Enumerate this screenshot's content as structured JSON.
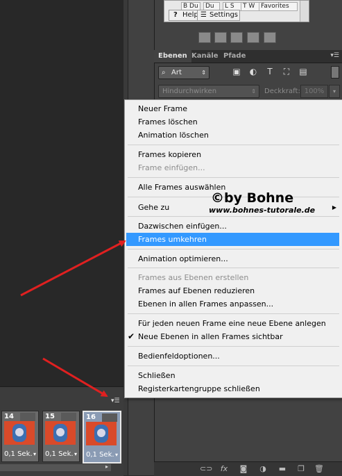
{
  "colors": {
    "menu_highlight": "#3399ff",
    "arrow": "#e02020",
    "panel_bg": "#424242"
  },
  "top_widget": {
    "cells": [
      "B Du",
      "Du",
      "L S",
      "T W",
      "Favorites"
    ],
    "help_tab": "Help",
    "settings_tab": "Settings",
    "help_icon": "question-icon",
    "settings_icon": "list-icon"
  },
  "layers_panel": {
    "tabs": [
      "Ebenen",
      "Kanäle",
      "Pfade"
    ],
    "active_tab": "Ebenen",
    "kind_filter": "Art",
    "filter_icons": [
      "image-filter-icon",
      "adjustment-filter-icon",
      "type-filter-icon",
      "shape-filter-icon",
      "smart-object-filter-icon"
    ],
    "blend_mode": "Hindurchwirken",
    "opacity_label": "Deckkraft:",
    "opacity_value": "100%",
    "bottom_icons": [
      "link-icon",
      "fx-icon",
      "mask-icon",
      "adjustment-icon",
      "folder-icon",
      "new-layer-icon",
      "trash-icon"
    ]
  },
  "timeline": {
    "frames": [
      {
        "number": "14",
        "delay": "0,1 Sek.",
        "selected": false
      },
      {
        "number": "15",
        "delay": "0,1 Sek.",
        "selected": false
      },
      {
        "number": "16",
        "delay": "0,1 Sek.",
        "selected": true
      }
    ]
  },
  "context_menu": {
    "items": [
      {
        "label": "Neuer Frame",
        "disabled": false
      },
      {
        "label": "Frames löschen",
        "disabled": false
      },
      {
        "label": "Animation löschen",
        "disabled": false
      },
      {
        "label": "Frames kopieren",
        "disabled": false
      },
      {
        "label": "Frame einfügen...",
        "disabled": true
      },
      {
        "label": "Alle Frames auswählen",
        "disabled": false
      },
      {
        "label": "Gehe zu",
        "disabled": false,
        "submenu": true
      },
      {
        "label": "Dazwischen einfügen...",
        "disabled": false
      },
      {
        "label": "Frames umkehren",
        "disabled": false,
        "highlighted": true
      },
      {
        "label": "Animation optimieren...",
        "disabled": false
      },
      {
        "label": "Frames aus Ebenen erstellen",
        "disabled": true
      },
      {
        "label": "Frames auf Ebenen reduzieren",
        "disabled": false
      },
      {
        "label": "Ebenen in allen Frames anpassen...",
        "disabled": false
      },
      {
        "label": "Für jeden neuen Frame eine neue Ebene anlegen",
        "disabled": false
      },
      {
        "label": "Neue Ebenen in allen Frames sichtbar",
        "disabled": false,
        "checked": true
      },
      {
        "label": "Bedienfeldoptionen...",
        "disabled": false
      },
      {
        "label": "Schließen",
        "disabled": false
      },
      {
        "label": "Registerkartengruppe schließen",
        "disabled": false
      }
    ]
  },
  "watermark": {
    "title": "©by Bohne",
    "url": "www.bohnes-tutorale.de"
  }
}
